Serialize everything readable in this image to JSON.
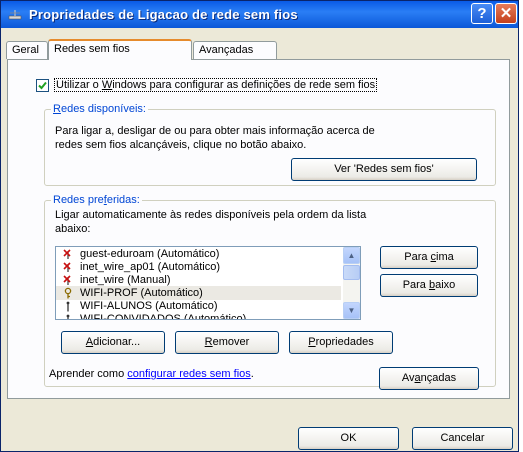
{
  "window": {
    "title": "Propriedades de Ligacao de rede sem fios",
    "help_glyph": "?",
    "close_glyph": "✕"
  },
  "tabs": [
    {
      "label": "Geral"
    },
    {
      "label": "Redes sem fios",
      "active": true
    },
    {
      "label": "Avançadas"
    }
  ],
  "use_windows": {
    "checked": true,
    "prefix": "Utilizar o ",
    "mnemonic": "W",
    "suffix": "indows para configurar as definições de rede sem fios"
  },
  "available": {
    "legend_mnemonic": "R",
    "legend_rest": "edes disponíveis:",
    "description_line1": "Para ligar a, desligar de ou para obter mais informação acerca de",
    "description_line2": "redes sem fios alcançáveis, clique no botão abaixo.",
    "view_button": "Ver 'Redes sem fios'"
  },
  "preferred": {
    "legend_prefix": "Redes pre",
    "legend_mnemonic": "f",
    "legend_rest": "eridas:",
    "description_line1": "Ligar automaticamente às redes disponíveis pela ordem da lista",
    "description_line2": "abaixo:",
    "networks": [
      {
        "name": "guest-eduroam (Automático)",
        "icon": "x-antenna-icon"
      },
      {
        "name": "inet_wire_ap01 (Automático)",
        "icon": "x-antenna-icon"
      },
      {
        "name": "inet_wire (Manual)",
        "icon": "x-antenna-icon"
      },
      {
        "name": "WIFI-PROF (Automático)",
        "icon": "key-antenna-icon",
        "selected": true
      },
      {
        "name": "WIFI-ALUNOS (Automático)",
        "icon": "antenna-icon"
      },
      {
        "name": "WIFI-CONVIDADOS (Automático)",
        "icon": "antenna-icon"
      }
    ],
    "move_up": {
      "prefix": "Para ",
      "mnemonic": "c",
      "rest": "ima"
    },
    "move_down": {
      "prefix": "Para ",
      "mnemonic": "b",
      "rest": "aixo"
    },
    "add": {
      "mnemonic": "A",
      "rest": "dicionar..."
    },
    "remove": {
      "mnemonic": "R",
      "rest": "emover"
    },
    "properties": {
      "mnemonic": "P",
      "rest": "ropriedades"
    }
  },
  "learn": {
    "prefix": "Aprender como ",
    "link": "configurar redes sem fios",
    "suffix": "."
  },
  "advanced_button": {
    "prefix": "Av",
    "mnemonic": "a",
    "rest": "nçadas"
  },
  "ok_button": "OK",
  "cancel_button": "Cancelar",
  "colors": {
    "titlebar": "#0a5ae6",
    "legend": "#0046d5",
    "link": "#0000ff",
    "tab_highlight": "#e68b2c"
  }
}
